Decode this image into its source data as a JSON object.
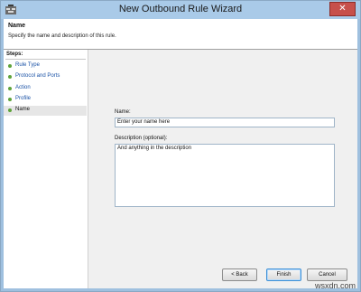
{
  "window": {
    "title": "New Outbound Rule Wizard",
    "close_label": "✕"
  },
  "header": {
    "title": "Name",
    "description": "Specify the name and description of this rule."
  },
  "steps": {
    "title": "Steps:",
    "items": [
      {
        "label": "Rule Type"
      },
      {
        "label": "Protocol and Ports"
      },
      {
        "label": "Action"
      },
      {
        "label": "Profile"
      },
      {
        "label": "Name"
      }
    ]
  },
  "form": {
    "name_label": "Name:",
    "name_value": "Enter your name here",
    "description_label": "Description (optional):",
    "description_value": "And anything in the description"
  },
  "buttons": {
    "back": "< Back",
    "finish": "Finish",
    "cancel": "Cancel"
  },
  "watermark": "wsxdn.com",
  "colors": {
    "titlebar": "#a9cae8",
    "step_complete": "#5ea33a",
    "link": "#1a52a6",
    "close": "#c7504b"
  }
}
